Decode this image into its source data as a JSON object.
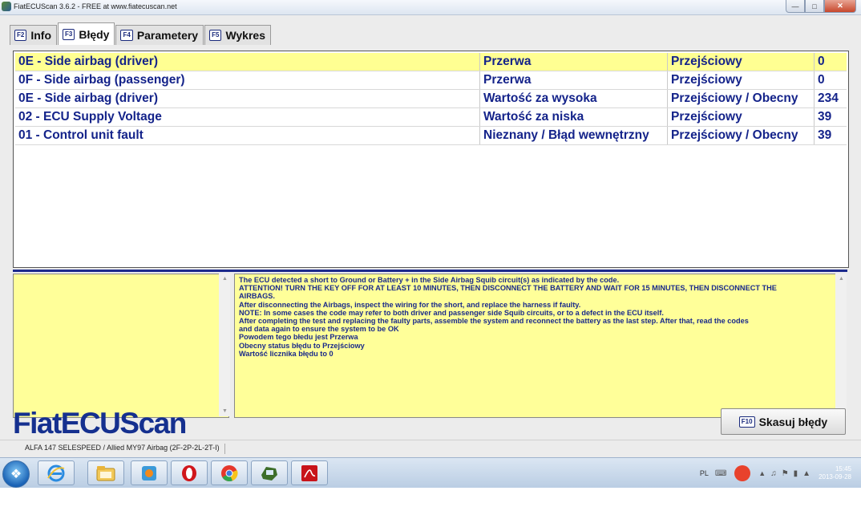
{
  "window": {
    "title": "FiatECUScan 3.6.2 - FREE at www.fiatecuscan.net"
  },
  "tabs": [
    {
      "key": "F2",
      "label": "Info"
    },
    {
      "key": "F3",
      "label": "Błędy"
    },
    {
      "key": "F4",
      "label": "Parametery"
    },
    {
      "key": "F5",
      "label": "Wykres"
    }
  ],
  "errors": [
    {
      "code": "0E - Side airbag (driver)",
      "type": "Przerwa",
      "status": "Przejściowy",
      "count": "0"
    },
    {
      "code": "0F - Side airbag (passenger)",
      "type": "Przerwa",
      "status": "Przejściowy",
      "count": "0"
    },
    {
      "code": "0E - Side airbag (driver)",
      "type": "Wartość za wysoka",
      "status": "Przejściowy / Obecny",
      "count": "234"
    },
    {
      "code": "02 - ECU Supply Voltage",
      "type": "Wartość za niska",
      "status": "Przejściowy",
      "count": "39"
    },
    {
      "code": "01 - Control unit fault",
      "type": "Nieznany / Błąd wewnętrzny",
      "status": "Przejściowy / Obecny",
      "count": "39"
    }
  ],
  "description": [
    "The ECU detected a short to Ground or Battery + in the Side Airbag Squib circuit(s) as indicated by the code.",
    "ATTENTION! TURN THE KEY OFF FOR AT LEAST 10 MINUTES, THEN DISCONNECT THE BATTERY AND WAIT FOR 15 MINUTES, THEN DISCONNECT THE",
    "AIRBAGS.",
    "After disconnecting the Airbags, inspect the wiring for the short, and replace the harness if faulty.",
    "NOTE: In some cases the code may refer to both driver and passenger side Squib circuits, or to a defect in the ECU itself.",
    "After completing the test and replacing the faulty parts, assemble the system and reconnect the battery as the last step. After that, read the codes",
    "and data again to ensure the system to be OK",
    "Powodem tego błedu jest Przerwa",
    "Obecny status błędu to Przejściowy",
    "Wartość licznika błędu to 0"
  ],
  "brand": "FiatECUScan",
  "clear_button": {
    "key": "F10",
    "label": "Skasuj błędy"
  },
  "status": "ALFA 147 SELESPEED / Allied MY97 Airbag (2F-2P-2L-2T-I)",
  "taskbar": {
    "lang": "PL",
    "time": "15:45",
    "date": "2013-09-28",
    "apps": [
      "internet-explorer-icon",
      "file-explorer-icon",
      "media-player-icon",
      "opera-icon",
      "chrome-icon",
      "fiatecuscan-icon",
      "pdf-reader-icon"
    ]
  }
}
